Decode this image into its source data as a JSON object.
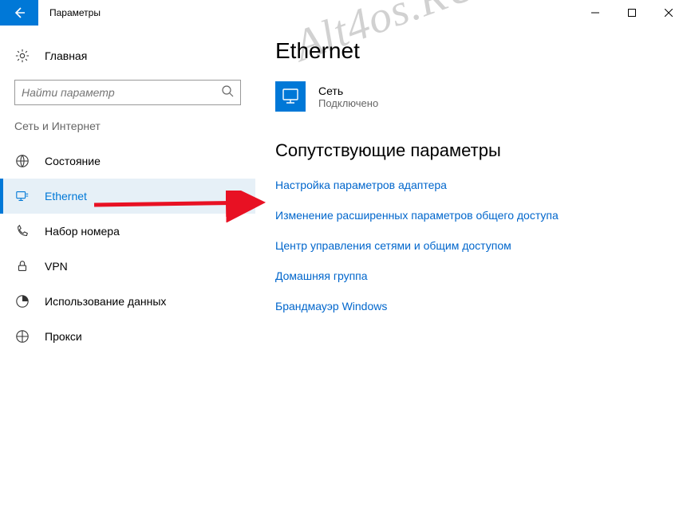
{
  "window": {
    "title": "Параметры"
  },
  "sidebar": {
    "home_label": "Главная",
    "search_placeholder": "Найти параметр",
    "group_title": "Сеть и Интернет",
    "items": [
      {
        "label": "Состояние"
      },
      {
        "label": "Ethernet"
      },
      {
        "label": "Набор номера"
      },
      {
        "label": "VPN"
      },
      {
        "label": "Использование данных"
      },
      {
        "label": "Прокси"
      }
    ]
  },
  "main": {
    "page_title": "Ethernet",
    "network": {
      "name": "Сеть",
      "status": "Подключено"
    },
    "related_title": "Сопутствующие параметры",
    "links": [
      "Настройка параметров адаптера",
      "Изменение расширенных параметров общего доступа",
      "Центр управления сетями и общим доступом",
      "Домашняя группа",
      "Брандмауэр Windows"
    ]
  },
  "watermark": "Alt4os.RU"
}
